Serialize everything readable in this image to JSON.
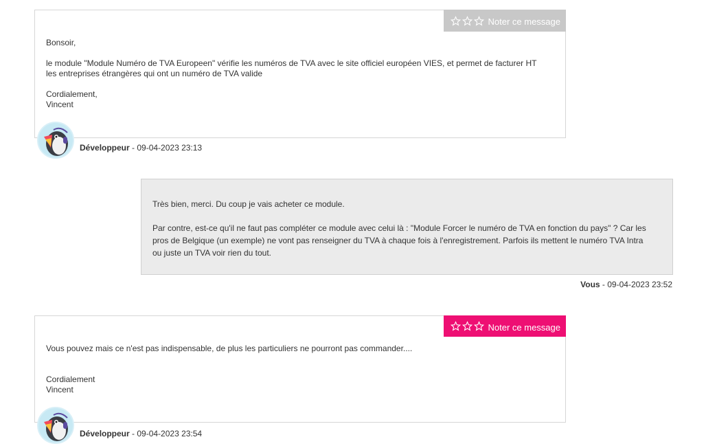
{
  "messages": [
    {
      "rate_label": "Noter ce message",
      "paragraphs": [
        "Bonsoir,",
        "le module \"Module Numéro de TVA Europeen\" vérifie les numéros de TVA avec le site officiel européen VIES, et permet de facturer HT les entreprises étrangères qui ont un numéro de TVA valide"
      ],
      "signature": [
        "Cordialement,",
        "Vincent"
      ],
      "author": "Développeur",
      "separator": " - ",
      "date": "09-04-2023 23:13"
    },
    {
      "paragraphs": [
        "Très bien, merci. Du coup je vais acheter ce module.",
        "Par contre, est-ce qu'il ne faut pas compléter ce module avec celui là : \"Module Forcer le numéro de TVA en fonction du pays\" ? Car les pros de Belgique (un exemple) ne vont pas renseigner du TVA à chaque fois à l'enregistrement. Parfois ils mettent le numéro TVA Intra ou juste un TVA voir rien du tout."
      ],
      "author": "Vous",
      "separator": " - ",
      "date": "09-04-2023 23:52"
    },
    {
      "rate_label": "Noter ce message",
      "paragraphs": [
        "Vous pouvez mais ce n'est pas indispensable, de plus les particuliers ne pourront pas commander...."
      ],
      "signature": [
        "Cordialement",
        "Vincent"
      ],
      "author": "Développeur",
      "separator": " - ",
      "date": "09-04-2023 23:54"
    }
  ],
  "colors": {
    "rate_grey": "#c8c8c8",
    "rate_pink": "#ee0f73",
    "self_bubble": "#ebebeb"
  },
  "icons": {
    "star": "star-outline-icon",
    "avatar": "prestashop-puffin-avatar"
  }
}
